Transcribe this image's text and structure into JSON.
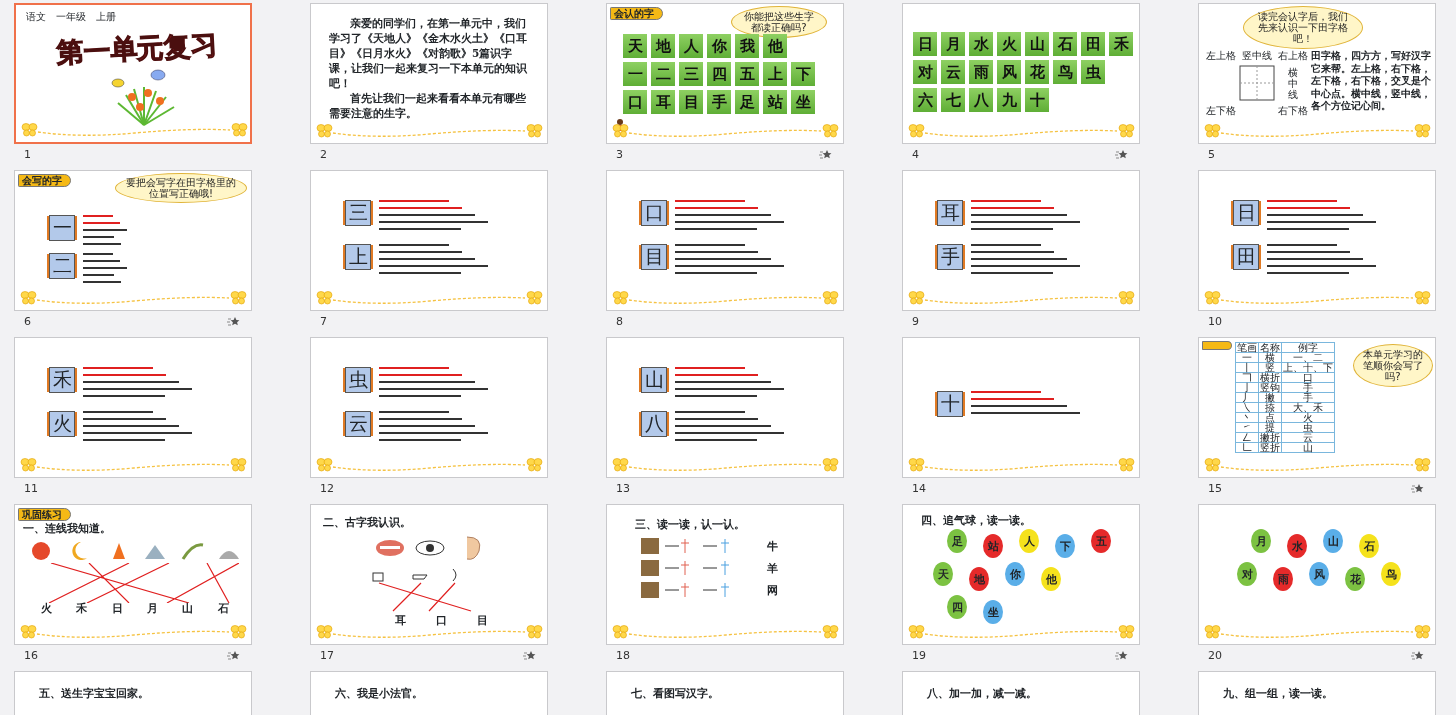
{
  "slides": [
    {
      "number": "1",
      "selected": true,
      "kind": "title",
      "header": "语文　一年级　上册",
      "title": "第一单元复习"
    },
    {
      "number": "2",
      "selected": false,
      "kind": "text",
      "paragraphs": [
        "亲爱的同学们，在第一单元中，我们学习了《天地人》《金木水火土》《口耳目》《日月水火》《对韵歌》5篇识字课，让我们一起来复习一下本单元的知识吧！",
        "首先让我们一起来看看本单元有哪些需要注意的生字。"
      ]
    },
    {
      "number": "3",
      "selected": false,
      "animated": true,
      "kind": "grid",
      "tag": "会认的字",
      "bubble": "你能把这些生字都读正确吗?",
      "rows": [
        [
          "天",
          "地",
          "人",
          "你",
          "我",
          "他"
        ],
        [
          "一",
          "二",
          "三",
          "四",
          "五",
          "上",
          "下"
        ],
        [
          "口",
          "耳",
          "目",
          "手",
          "足",
          "站",
          "坐"
        ]
      ]
    },
    {
      "number": "4",
      "selected": false,
      "animated": true,
      "kind": "grid",
      "rows": [
        [
          "日",
          "月",
          "水",
          "火",
          "山",
          "石",
          "田",
          "禾"
        ],
        [
          "对",
          "云",
          "雨",
          "风",
          "花",
          "鸟",
          "虫"
        ],
        [
          "六",
          "七",
          "八",
          "九",
          "十"
        ]
      ]
    },
    {
      "number": "5",
      "selected": false,
      "kind": "tianzige",
      "bubble": "读完会认字后，我们先来认识一下田字格吧！",
      "labels": [
        "左上格",
        "竖中线",
        "右上格",
        "横中线",
        "左下格",
        "右下格"
      ],
      "text": "田字格，四方方，写好汉字它来帮。左上格，右下格，左下格，右下格，交叉是个中心点。横中线，竖中线，各个方位记心间。"
    },
    {
      "number": "6",
      "selected": false,
      "animated": true,
      "kind": "strokes",
      "tag": "会写的字",
      "bubble": "要把会写字在田字格里的位置写正确哦!",
      "chars": [
        "一",
        "二"
      ]
    },
    {
      "number": "7",
      "selected": false,
      "kind": "strokes",
      "chars": [
        "三",
        "上"
      ]
    },
    {
      "number": "8",
      "selected": false,
      "kind": "strokes",
      "chars": [
        "口",
        "目"
      ]
    },
    {
      "number": "9",
      "selected": false,
      "kind": "strokes",
      "chars": [
        "耳",
        "手"
      ]
    },
    {
      "number": "10",
      "selected": false,
      "kind": "strokes",
      "chars": [
        "日",
        "田"
      ]
    },
    {
      "number": "11",
      "selected": false,
      "kind": "strokes",
      "chars": [
        "禾",
        "火"
      ]
    },
    {
      "number": "12",
      "selected": false,
      "kind": "strokes",
      "chars": [
        "虫",
        "云"
      ]
    },
    {
      "number": "13",
      "selected": false,
      "kind": "strokes",
      "chars": [
        "山",
        "八"
      ]
    },
    {
      "number": "14",
      "selected": false,
      "kind": "strokes",
      "chars": [
        "十"
      ]
    },
    {
      "number": "15",
      "selected": false,
      "animated": true,
      "kind": "table",
      "bubble": "本单元学习的笔顺你会写了吗?",
      "columns": [
        "笔画",
        "名称",
        "例字"
      ],
      "rows": [
        [
          "一",
          "横",
          "一、二"
        ],
        [
          "丨",
          "竖",
          "上、十、下"
        ],
        [
          "𠃍",
          "横折",
          "口"
        ],
        [
          "亅",
          "竖钩",
          "手"
        ],
        [
          "丿",
          "撇",
          "手"
        ],
        [
          "㇏",
          "捺",
          "大、禾"
        ],
        [
          "丶",
          "点",
          "火"
        ],
        [
          "㇀",
          "提",
          "虫"
        ],
        [
          "𠃋",
          "撇折",
          "云"
        ],
        [
          "𠃊",
          "竖折",
          "山"
        ]
      ]
    },
    {
      "number": "16",
      "selected": false,
      "animated": true,
      "kind": "match",
      "tag": "巩固练习",
      "title": "一、连线我知道。",
      "chars": [
        "火",
        "禾",
        "日",
        "月",
        "山",
        "石"
      ]
    },
    {
      "number": "17",
      "selected": false,
      "animated": true,
      "kind": "ancient",
      "title": "二、古字我认识。",
      "chars": [
        "耳",
        "口",
        "目"
      ]
    },
    {
      "number": "18",
      "selected": false,
      "kind": "evolution",
      "title": "三、读一读，认一认。",
      "chars": [
        "牛",
        "羊",
        "网"
      ]
    },
    {
      "number": "19",
      "selected": false,
      "animated": true,
      "kind": "balloons",
      "title": "四、追气球，读一读。",
      "rows": [
        [
          {
            "char": "足",
            "color": "#7cc242"
          },
          {
            "char": "站",
            "color": "#e52a2a"
          },
          {
            "char": "人",
            "color": "#f5e21c"
          },
          {
            "char": "下",
            "color": "#5aaee8"
          },
          {
            "char": "五",
            "color": "#e52a2a"
          }
        ],
        [
          {
            "char": "天",
            "color": "#7cc242"
          },
          {
            "char": "地",
            "color": "#e52a2a"
          },
          {
            "char": "你",
            "color": "#5aaee8"
          },
          {
            "char": "他",
            "color": "#f5e21c"
          }
        ],
        [
          {
            "char": "四",
            "color": "#7cc242"
          },
          {
            "char": "坐",
            "color": "#5aaee8"
          }
        ]
      ]
    },
    {
      "number": "20",
      "selected": false,
      "animated": true,
      "kind": "balloons",
      "rows": [
        [
          {
            "char": "月",
            "color": "#7cc242"
          },
          {
            "char": "水",
            "color": "#e52a2a"
          },
          {
            "char": "山",
            "color": "#5aaee8"
          },
          {
            "char": "石",
            "color": "#f5e21c"
          }
        ],
        [
          {
            "char": "对",
            "color": "#7cc242"
          },
          {
            "char": "雨",
            "color": "#e52a2a"
          },
          {
            "char": "风",
            "color": "#5aaee8"
          },
          {
            "char": "花",
            "color": "#7cc242"
          },
          {
            "char": "鸟",
            "color": "#f5e21c"
          }
        ]
      ]
    },
    {
      "selected": false,
      "kind": "exercise",
      "title": "五、送生字宝宝回家。"
    },
    {
      "selected": false,
      "kind": "exercise",
      "title": "六、我是小法官。"
    },
    {
      "selected": false,
      "kind": "exercise",
      "title": "七、看图写汉字。"
    },
    {
      "selected": false,
      "kind": "exercise",
      "title": "八、加一加，减一减。"
    },
    {
      "selected": false,
      "kind": "exercise",
      "title": "九、组一组，读一读。"
    }
  ]
}
